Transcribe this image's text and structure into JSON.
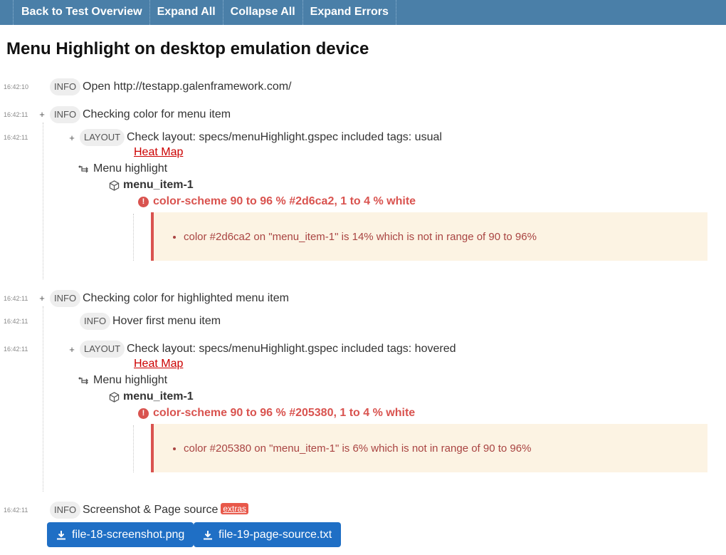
{
  "toolbar": {
    "back_label": "Back to Test Overview",
    "expand_all_label": "Expand All",
    "collapse_all_label": "Collapse All",
    "expand_errors_label": "Expand Errors"
  },
  "page_title": "Menu Highlight on desktop emulation device",
  "entries": [
    {
      "time": "16:42:10",
      "tag": "INFO",
      "message": "Open http://testapp.galenframework.com/"
    },
    {
      "time": "16:42:11",
      "tag": "INFO",
      "message": "Checking color for menu item"
    },
    {
      "time": "16:42:11",
      "tag": "LAYOUT",
      "message": "Check layout: specs/menuHighlight.gspec included tags: usual",
      "heatmap": "Heat Map",
      "section": "Menu highlight",
      "object": "menu_item-1",
      "spec": "color-scheme 90 to 96 % #2d6ca2, 1 to 4 % white",
      "error": "color #2d6ca2 on \"menu_item-1\" is 14% which is not in range of 90 to 96%"
    },
    {
      "time": "16:42:11",
      "tag": "INFO",
      "message": "Checking color for highlighted menu item"
    },
    {
      "time": "16:42:11",
      "tag": "INFO",
      "message": "Hover first menu item"
    },
    {
      "time": "16:42:11",
      "tag": "LAYOUT",
      "message": "Check layout: specs/menuHighlight.gspec included tags: hovered",
      "heatmap": "Heat Map",
      "section": "Menu highlight",
      "object": "menu_item-1",
      "spec": "color-scheme 90 to 96 % #205380, 1 to 4 % white",
      "error": "color #205380 on \"menu_item-1\" is 6% which is not in range of 90 to 96%"
    },
    {
      "time": "16:42:11",
      "tag": "INFO",
      "message": "Screenshot & Page source",
      "badge": "extras"
    }
  ],
  "files": [
    "file-18-screenshot.png",
    "file-19-page-source.txt"
  ],
  "expander_glyph": "+",
  "icons": {
    "section": "section-branch-icon",
    "object": "cube-icon",
    "error": "exclamation-circle-icon",
    "download": "download-icon"
  },
  "colors": {
    "topbar": "#4a7fa8",
    "error": "#d9534f",
    "error_text": "#a94442",
    "error_box": "#fcf3e3",
    "link": "#cc0000",
    "file_button": "#1f6fc5"
  }
}
